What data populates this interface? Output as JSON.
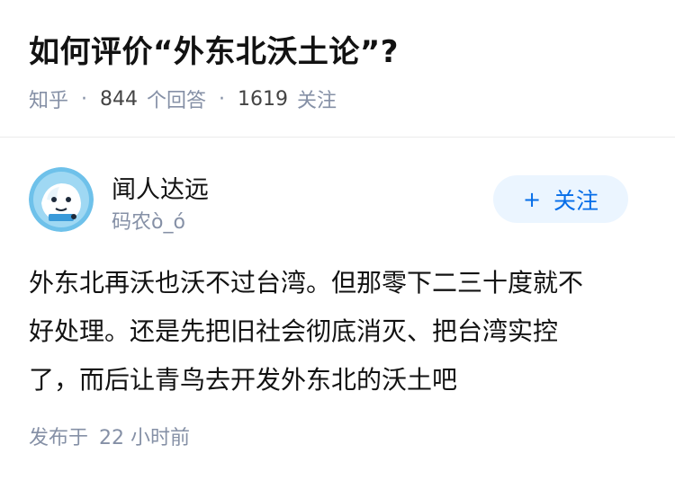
{
  "question": {
    "title": "如何评价“外东北沃土论”?",
    "source": "知乎",
    "answer_count": "844",
    "answer_label": "个回答",
    "follower_count": "1619",
    "follower_label": "关注"
  },
  "author": {
    "name": "闻人达远",
    "bio": "码农ò_ó",
    "avatar_icon": "shark-avatar-icon",
    "follow_label": "关注",
    "follow_color": "#056de8"
  },
  "answer": {
    "lines": [
      "外东北再沃也沃不过台湾。但那零下二三十度就不",
      "好处理。还是先把旧社会彻底消灭、把台湾实控",
      "了，而后让青鸟去开发外东北的沃土吧"
    ],
    "posted_label": "发布于",
    "posted_time": "22 小时前"
  }
}
